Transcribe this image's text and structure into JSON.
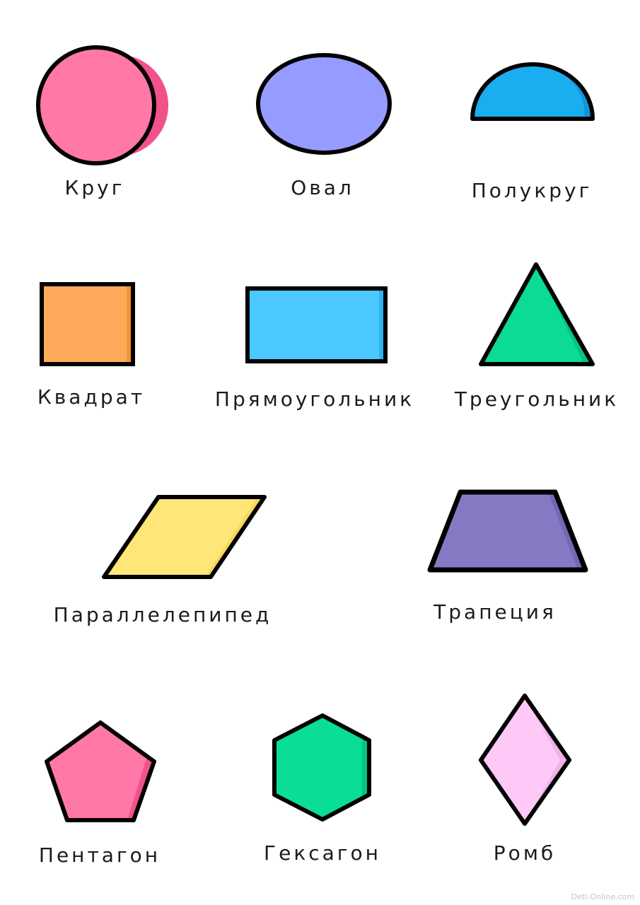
{
  "shapes": [
    {
      "key": "circle",
      "name": "Круг",
      "fill": "#FF78A7",
      "shade": "#F2528C"
    },
    {
      "key": "oval",
      "name": "Овал",
      "fill": "#969BFF",
      "shade": "#7C7FF2"
    },
    {
      "key": "semicircle",
      "name": "Полукруг",
      "fill": "#1AAEF0",
      "shade": "#1296D8"
    },
    {
      "key": "square",
      "name": "Квадрат",
      "fill": "#FDAB5B",
      "shade": "#F4952F"
    },
    {
      "key": "rectangle",
      "name": "Прямоугольник",
      "fill": "#4BC8FF",
      "shade": "#2EB2F2"
    },
    {
      "key": "triangle",
      "name": "Треугольник",
      "fill": "#0BDB94",
      "shade": "#05C481"
    },
    {
      "key": "parallelogram",
      "name": "Параллелепипед",
      "fill": "#FEE778",
      "shade": "#F6D85A"
    },
    {
      "key": "trapezoid",
      "name": "Трапеция",
      "fill": "#8679C4",
      "shade": "#7566B6"
    },
    {
      "key": "pentagon",
      "name": "Пентагон",
      "fill": "#FF78A7",
      "shade": "#F2528C"
    },
    {
      "key": "hexagon",
      "name": "Гексагон",
      "fill": "#09DD98",
      "shade": "#05C482"
    },
    {
      "key": "rhombus",
      "name": "Ромб",
      "fill": "#FFC9F7",
      "shade": "#F2B1EA"
    }
  ],
  "outline_color": "#000000",
  "watermark": "Deti-Online.com"
}
